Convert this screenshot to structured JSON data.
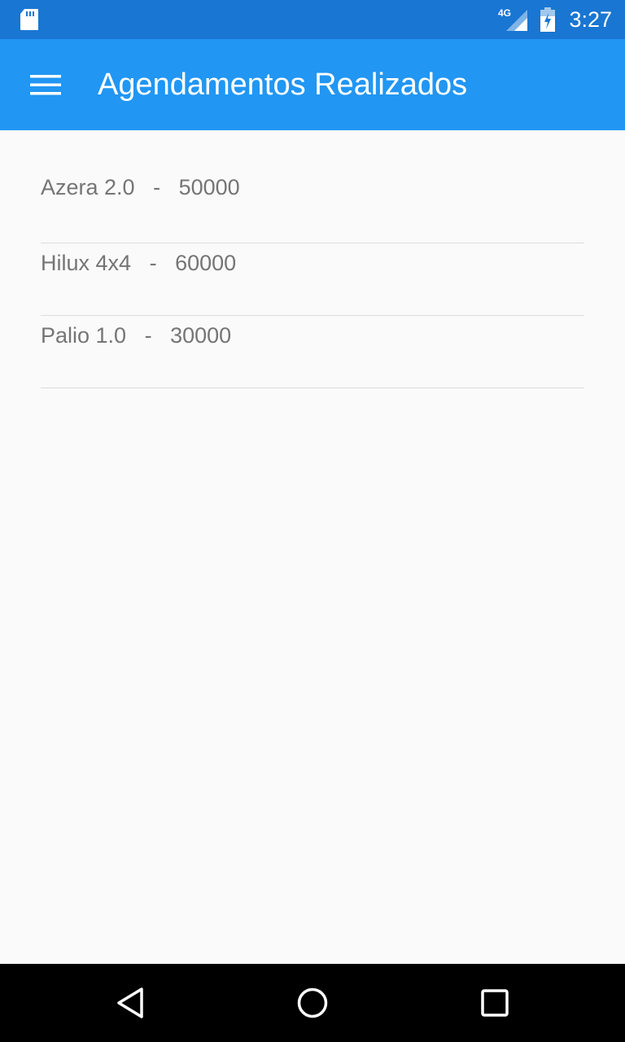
{
  "status_bar": {
    "time": "3:27",
    "network": "4G",
    "icons": [
      "sd-card-icon",
      "signal-icon",
      "battery-icon"
    ]
  },
  "toolbar": {
    "title": "Agendamentos Realizados",
    "menu_icon": "hamburger-menu-icon",
    "color": "#2196f3"
  },
  "items": [
    {
      "model": "Azera 2.0",
      "separator": "-",
      "value": "50000"
    },
    {
      "model": "Hilux 4x4",
      "separator": "-",
      "value": "60000"
    },
    {
      "model": "Palio 1.0",
      "separator": "-",
      "value": "30000"
    }
  ],
  "nav_bar": {
    "icons": [
      "back-icon",
      "home-icon",
      "recents-icon"
    ]
  },
  "colors": {
    "status_bar": "#1976d2",
    "accent": "#2196f3",
    "background": "#fafafa",
    "text": "#757575"
  }
}
